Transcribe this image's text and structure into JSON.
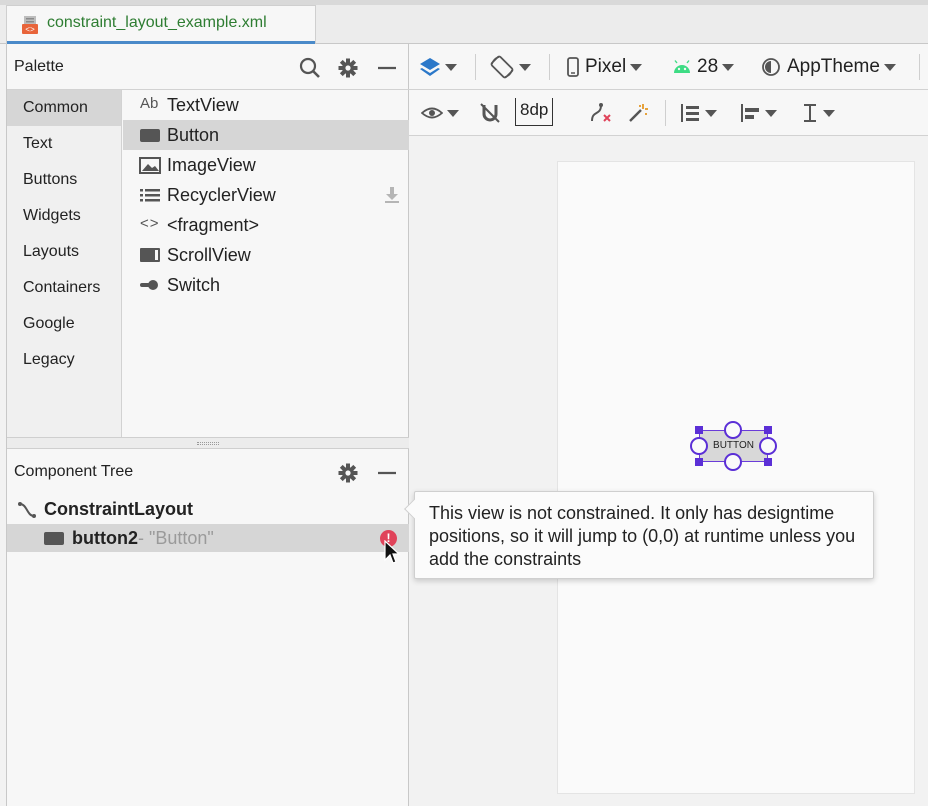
{
  "tab": {
    "title": "constraint_layout_example.xml"
  },
  "palette": {
    "title": "Palette",
    "categories": [
      "Common",
      "Text",
      "Buttons",
      "Widgets",
      "Layouts",
      "Containers",
      "Google",
      "Legacy"
    ],
    "selected_category": "Common",
    "items": [
      {
        "label": "TextView",
        "icon": "textview-icon",
        "icon_text": "Ab"
      },
      {
        "label": "Button",
        "icon": "button-icon",
        "selected": true
      },
      {
        "label": "ImageView",
        "icon": "image-icon"
      },
      {
        "label": "RecyclerView",
        "icon": "list-icon",
        "downloadable": true
      },
      {
        "label": "<fragment>",
        "icon": "code-brackets-icon",
        "icon_text": "<>"
      },
      {
        "label": "ScrollView",
        "icon": "scrollview-icon"
      },
      {
        "label": "Switch",
        "icon": "switch-icon"
      }
    ]
  },
  "component_tree": {
    "title": "Component Tree",
    "root": "ConstraintLayout",
    "child": {
      "name": "button2",
      "detail": "- \"Button\"",
      "has_error": true
    }
  },
  "toolbar_top": {
    "device": "Pixel",
    "api_level": "28",
    "theme": "AppTheme"
  },
  "toolbar_second": {
    "margin": "8dp"
  },
  "design_surface": {
    "button_text": "BUTTON"
  },
  "tooltip": {
    "text": "This view is not constrained. It only has designtime positions, so it will jump to (0,0) at runtime unless you add the constraints"
  },
  "colors": {
    "accent": "#4a8ac9",
    "selection": "#5b2fd6",
    "error": "#e0435a",
    "file_name": "#2e7d32",
    "android_green": "#3ddc84"
  }
}
